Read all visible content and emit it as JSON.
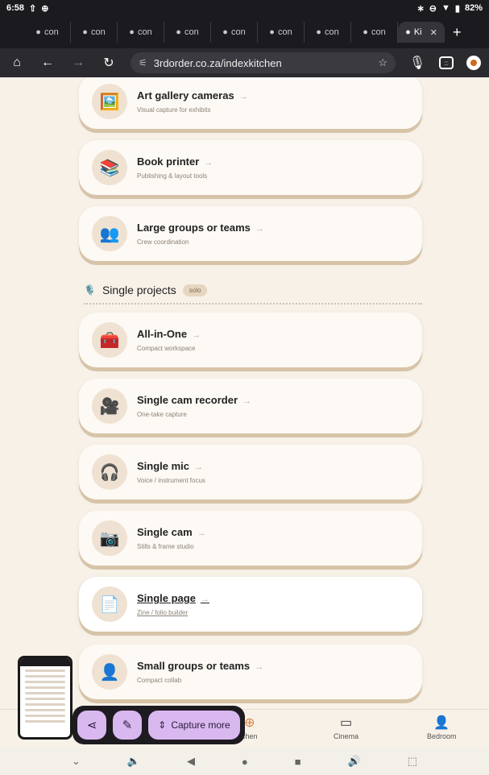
{
  "status_bar": {
    "time": "6:58",
    "left_icons": [
      "upload-icon",
      "vpn-icon"
    ],
    "battery": "82%"
  },
  "tabs": {
    "items": [
      {
        "label": "con"
      },
      {
        "label": "con"
      },
      {
        "label": "con"
      },
      {
        "label": "con"
      },
      {
        "label": "con"
      },
      {
        "label": "con"
      },
      {
        "label": "con"
      },
      {
        "label": "con"
      }
    ],
    "active": {
      "label": "Ki"
    }
  },
  "address": {
    "url": "3rdorder.co.za/indexkitchen",
    "tab_count": "::"
  },
  "cards_top": [
    {
      "title": "Art gallery cameras",
      "subtitle": "Visual capture for exhibits",
      "emoji": "🖼️"
    },
    {
      "title": "Book printer",
      "subtitle": "Publishing & layout tools",
      "emoji": "📚"
    },
    {
      "title": "Large groups or teams",
      "subtitle": "Crew coordination",
      "emoji": "👥"
    }
  ],
  "section": {
    "title": "Single projects",
    "badge": "solo",
    "icon": "🎙️"
  },
  "cards_bottom": [
    {
      "title": "All-in-One",
      "subtitle": "Compact workspace",
      "emoji": "🧰"
    },
    {
      "title": "Single cam recorder",
      "subtitle": "One-take capture",
      "emoji": "🎥"
    },
    {
      "title": "Single mic",
      "subtitle": "Voice / instrument focus",
      "emoji": "🎧"
    },
    {
      "title": "Single cam",
      "subtitle": "Stills & frame studio",
      "emoji": "📷"
    },
    {
      "title": "Single page",
      "subtitle": "Zine / folio builder",
      "emoji": "📄"
    },
    {
      "title": "Small groups or teams",
      "subtitle": "Compact collab",
      "emoji": "👤"
    }
  ],
  "arrow": "→",
  "bottom_nav": [
    {
      "label": "chen",
      "icon": "plus-circle-icon"
    },
    {
      "label": "Cinema",
      "icon": "monitor-icon"
    },
    {
      "label": "Bedroom",
      "icon": "person-icon"
    }
  ],
  "capture": {
    "button_label": "Capture more"
  },
  "colors": {
    "accent": "#d9b8f0",
    "card_shadow": "#d7c4a8",
    "page_bg": "#f7f1e8"
  }
}
